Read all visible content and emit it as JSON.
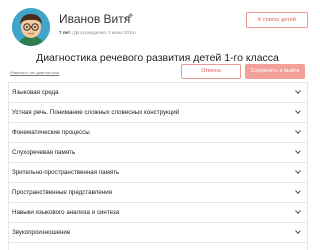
{
  "profile": {
    "name": "Иванов Витя",
    "age": "7 лет",
    "birth_info": "| Дата рождения: 1 июня 2018 г."
  },
  "header": {
    "back_button": "К списку детей"
  },
  "diagnostics": {
    "title": "Диагностика речевого развития детей 1-го класса",
    "change_link": "Изменить тип диагностики",
    "cancel_button": "Отмена",
    "save_button": "Сохранить и выйти"
  },
  "sections": [
    {
      "label": "Языковая среда"
    },
    {
      "label": "Устная речь. Понимание сложных словесных конструкций"
    },
    {
      "label": "Фонематические процессы"
    },
    {
      "label": "Слухоречевая память"
    },
    {
      "label": "Зрительно-пространственная память"
    },
    {
      "label": "Пространственные представления"
    },
    {
      "label": "Навыки языкового анализа и синтеза"
    },
    {
      "label": "Звукопроизношение"
    }
  ],
  "icons": {
    "edit": "pencil-icon",
    "expand": "chevron-down-icon",
    "avatar": "child-avatar"
  },
  "colors": {
    "accent": "#e0655c",
    "accent_light": "#f4a09a",
    "avatar_bg": "#3fa6c9"
  }
}
